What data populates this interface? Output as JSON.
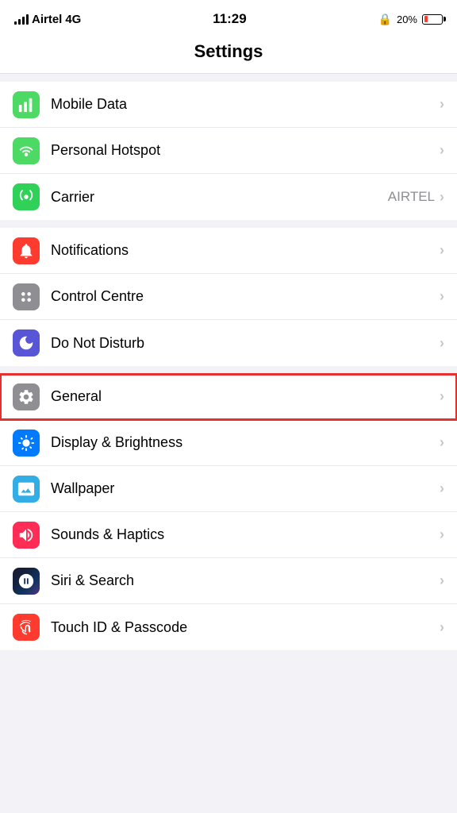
{
  "statusBar": {
    "carrier": "Airtel",
    "network": "4G",
    "time": "11:29",
    "batteryPercent": "20%",
    "batteryLevel": 20
  },
  "pageTitle": "Settings",
  "sections": [
    {
      "id": "network",
      "items": [
        {
          "id": "mobile-data",
          "label": "Mobile Data",
          "iconBg": "bg-green",
          "iconType": "signal",
          "value": "",
          "highlighted": false
        },
        {
          "id": "personal-hotspot",
          "label": "Personal Hotspot",
          "iconBg": "bg-green",
          "iconType": "hotspot",
          "value": "",
          "highlighted": false
        },
        {
          "id": "carrier",
          "label": "Carrier",
          "iconBg": "bg-green2",
          "iconType": "phone",
          "value": "AIRTEL",
          "highlighted": false
        }
      ]
    },
    {
      "id": "system1",
      "items": [
        {
          "id": "notifications",
          "label": "Notifications",
          "iconBg": "bg-red",
          "iconType": "notifications",
          "value": "",
          "highlighted": false
        },
        {
          "id": "control-centre",
          "label": "Control Centre",
          "iconBg": "bg-gray",
          "iconType": "sliders",
          "value": "",
          "highlighted": false
        },
        {
          "id": "do-not-disturb",
          "label": "Do Not Disturb",
          "iconBg": "bg-purple",
          "iconType": "moon",
          "value": "",
          "highlighted": false
        }
      ]
    },
    {
      "id": "system2",
      "items": [
        {
          "id": "general",
          "label": "General",
          "iconBg": "bg-gray",
          "iconType": "gear",
          "value": "",
          "highlighted": true
        },
        {
          "id": "display-brightness",
          "label": "Display & Brightness",
          "iconBg": "bg-blue",
          "iconType": "display",
          "value": "",
          "highlighted": false
        },
        {
          "id": "wallpaper",
          "label": "Wallpaper",
          "iconBg": "bg-cyan",
          "iconType": "wallpaper",
          "value": "",
          "highlighted": false
        },
        {
          "id": "sounds-haptics",
          "label": "Sounds & Haptics",
          "iconBg": "bg-pink",
          "iconType": "sound",
          "value": "",
          "highlighted": false
        },
        {
          "id": "siri-search",
          "label": "Siri & Search",
          "iconBg": "bg-siri",
          "iconType": "siri",
          "value": "",
          "highlighted": false
        },
        {
          "id": "touch-id",
          "label": "Touch ID & Passcode",
          "iconBg": "bg-touch",
          "iconType": "fingerprint",
          "value": "",
          "highlighted": false
        }
      ]
    }
  ]
}
